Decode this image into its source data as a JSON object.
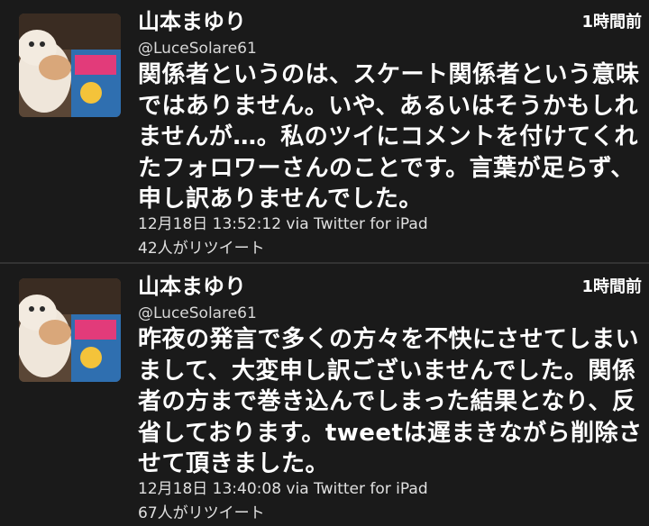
{
  "tweets": [
    {
      "user_name": "山本まゆり",
      "handle": "@LuceSolare61",
      "relative_time": "1時間前",
      "text": "関係者というのは、スケート関係者という意味ではありません。いや、あるいはそうかもしれませんが…。私のツイにコメントを付けてくれたフォロワーさんのことです。言葉が足らず、申し訳ありませんでした。",
      "timestamp_via": "12月18日 13:52:12 via Twitter for iPad",
      "retweet_text": "42人がリツイート"
    },
    {
      "user_name": "山本まゆり",
      "handle": "@LuceSolare61",
      "relative_time": "1時間前",
      "text": "昨夜の発言で多くの方々を不快にさせてしまいまして、大変申し訳ございませんでした。関係者の方まで巻き込んでしまった結果となり、反省しております。tweetは遅まきながら削除させて頂きました。",
      "timestamp_via": "12月18日 13:40:08 via Twitter for iPad",
      "retweet_text": "67人がリツイート"
    }
  ]
}
